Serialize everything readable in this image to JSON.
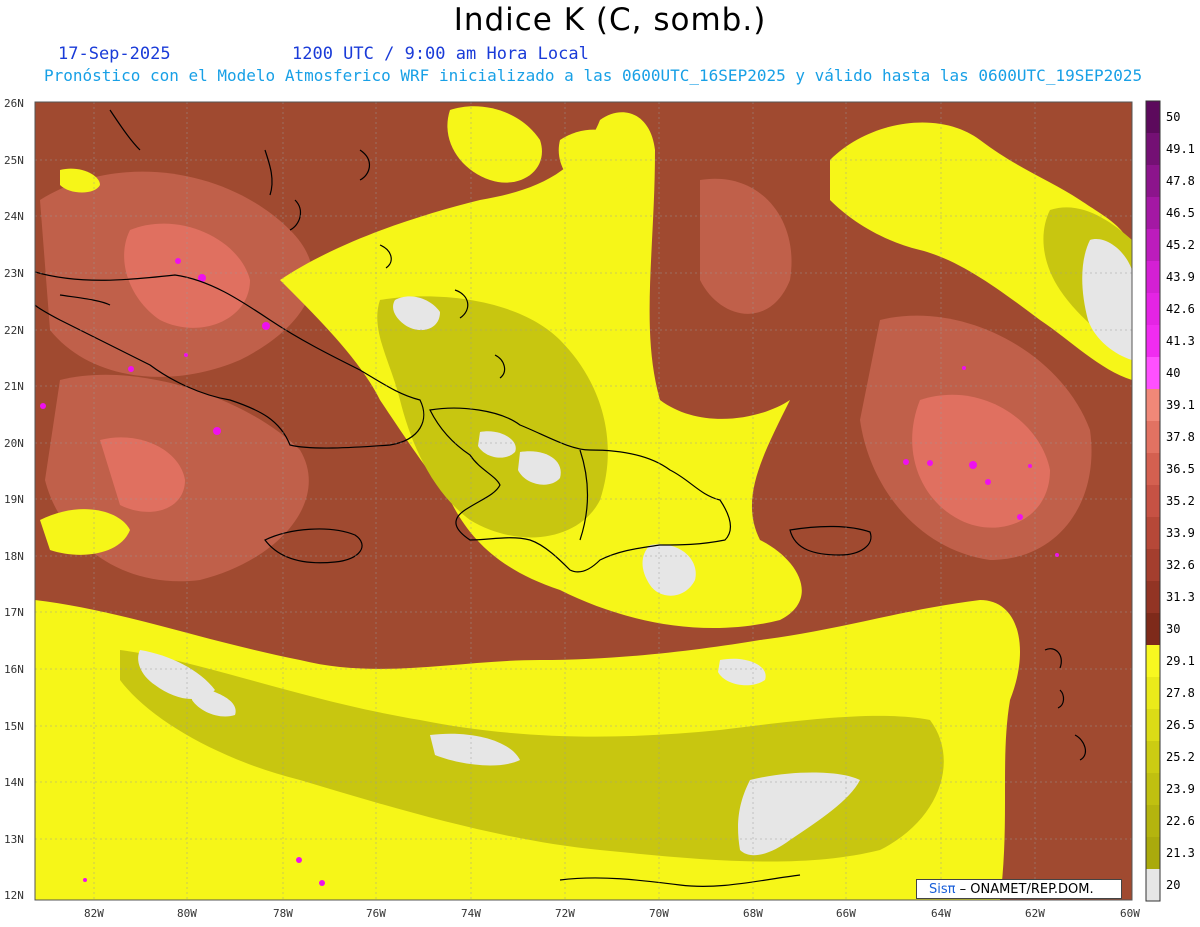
{
  "header": {
    "title": "Indice K (C, somb.)",
    "date": "17-Sep-2025",
    "time": "1200 UTC / 9:00 am Hora Local",
    "subtitle": "Pronóstico con el Modelo Atmosferico WRF inicializado a las 0600UTC_16SEP2025 y válido hasta las  0600UTC_19SEP2025"
  },
  "map": {
    "lon_range": [
      -83.3,
      -60
    ],
    "lat_range": [
      11.8,
      26.1
    ],
    "lat_labels": [
      "26N",
      "25N",
      "24N",
      "23N",
      "22N",
      "21N",
      "20N",
      "19N",
      "18N",
      "17N",
      "16N",
      "15N",
      "14N",
      "13N",
      "12N"
    ],
    "lon_labels": [
      "82W",
      "80W",
      "78W",
      "76W",
      "74W",
      "72W",
      "70W",
      "68W",
      "66W",
      "64W",
      "62W",
      "60W"
    ],
    "colors": {
      "gray": "#e6e6e6",
      "olive": "#c8c610",
      "yellow": "#f6f618",
      "brown": "#a04a30",
      "brownlight": "#c0604a",
      "salmon": "#e07060",
      "magenta": "#ee10ee"
    }
  },
  "colorbar": {
    "labels": [
      "50",
      "49.1",
      "47.8",
      "46.5",
      "45.2",
      "43.9",
      "42.6",
      "41.3",
      "40",
      "39.1",
      "37.8",
      "36.5",
      "35.2",
      "33.9",
      "32.6",
      "31.3",
      "30",
      "29.1",
      "27.8",
      "26.5",
      "25.2",
      "23.9",
      "22.6",
      "21.3",
      "20"
    ],
    "colors": [
      "#5c0a5c",
      "#741074",
      "#8c148c",
      "#a418a4",
      "#bc1cbc",
      "#d420d4",
      "#e424e4",
      "#f02cf0",
      "#ff50ff",
      "#f08878",
      "#e27262",
      "#d46050",
      "#c65244",
      "#b64838",
      "#a43e2e",
      "#923424",
      "#7e2a1a",
      "#f8f820",
      "#eaea1a",
      "#dcdc16",
      "#cccc12",
      "#c0c010",
      "#b4b40e",
      "#aaaa0c",
      "#e6e6e6"
    ]
  },
  "credit": {
    "logo": "Sis",
    "logo_symbol": "π",
    "text": "– ONAMET/REP.DOM."
  }
}
